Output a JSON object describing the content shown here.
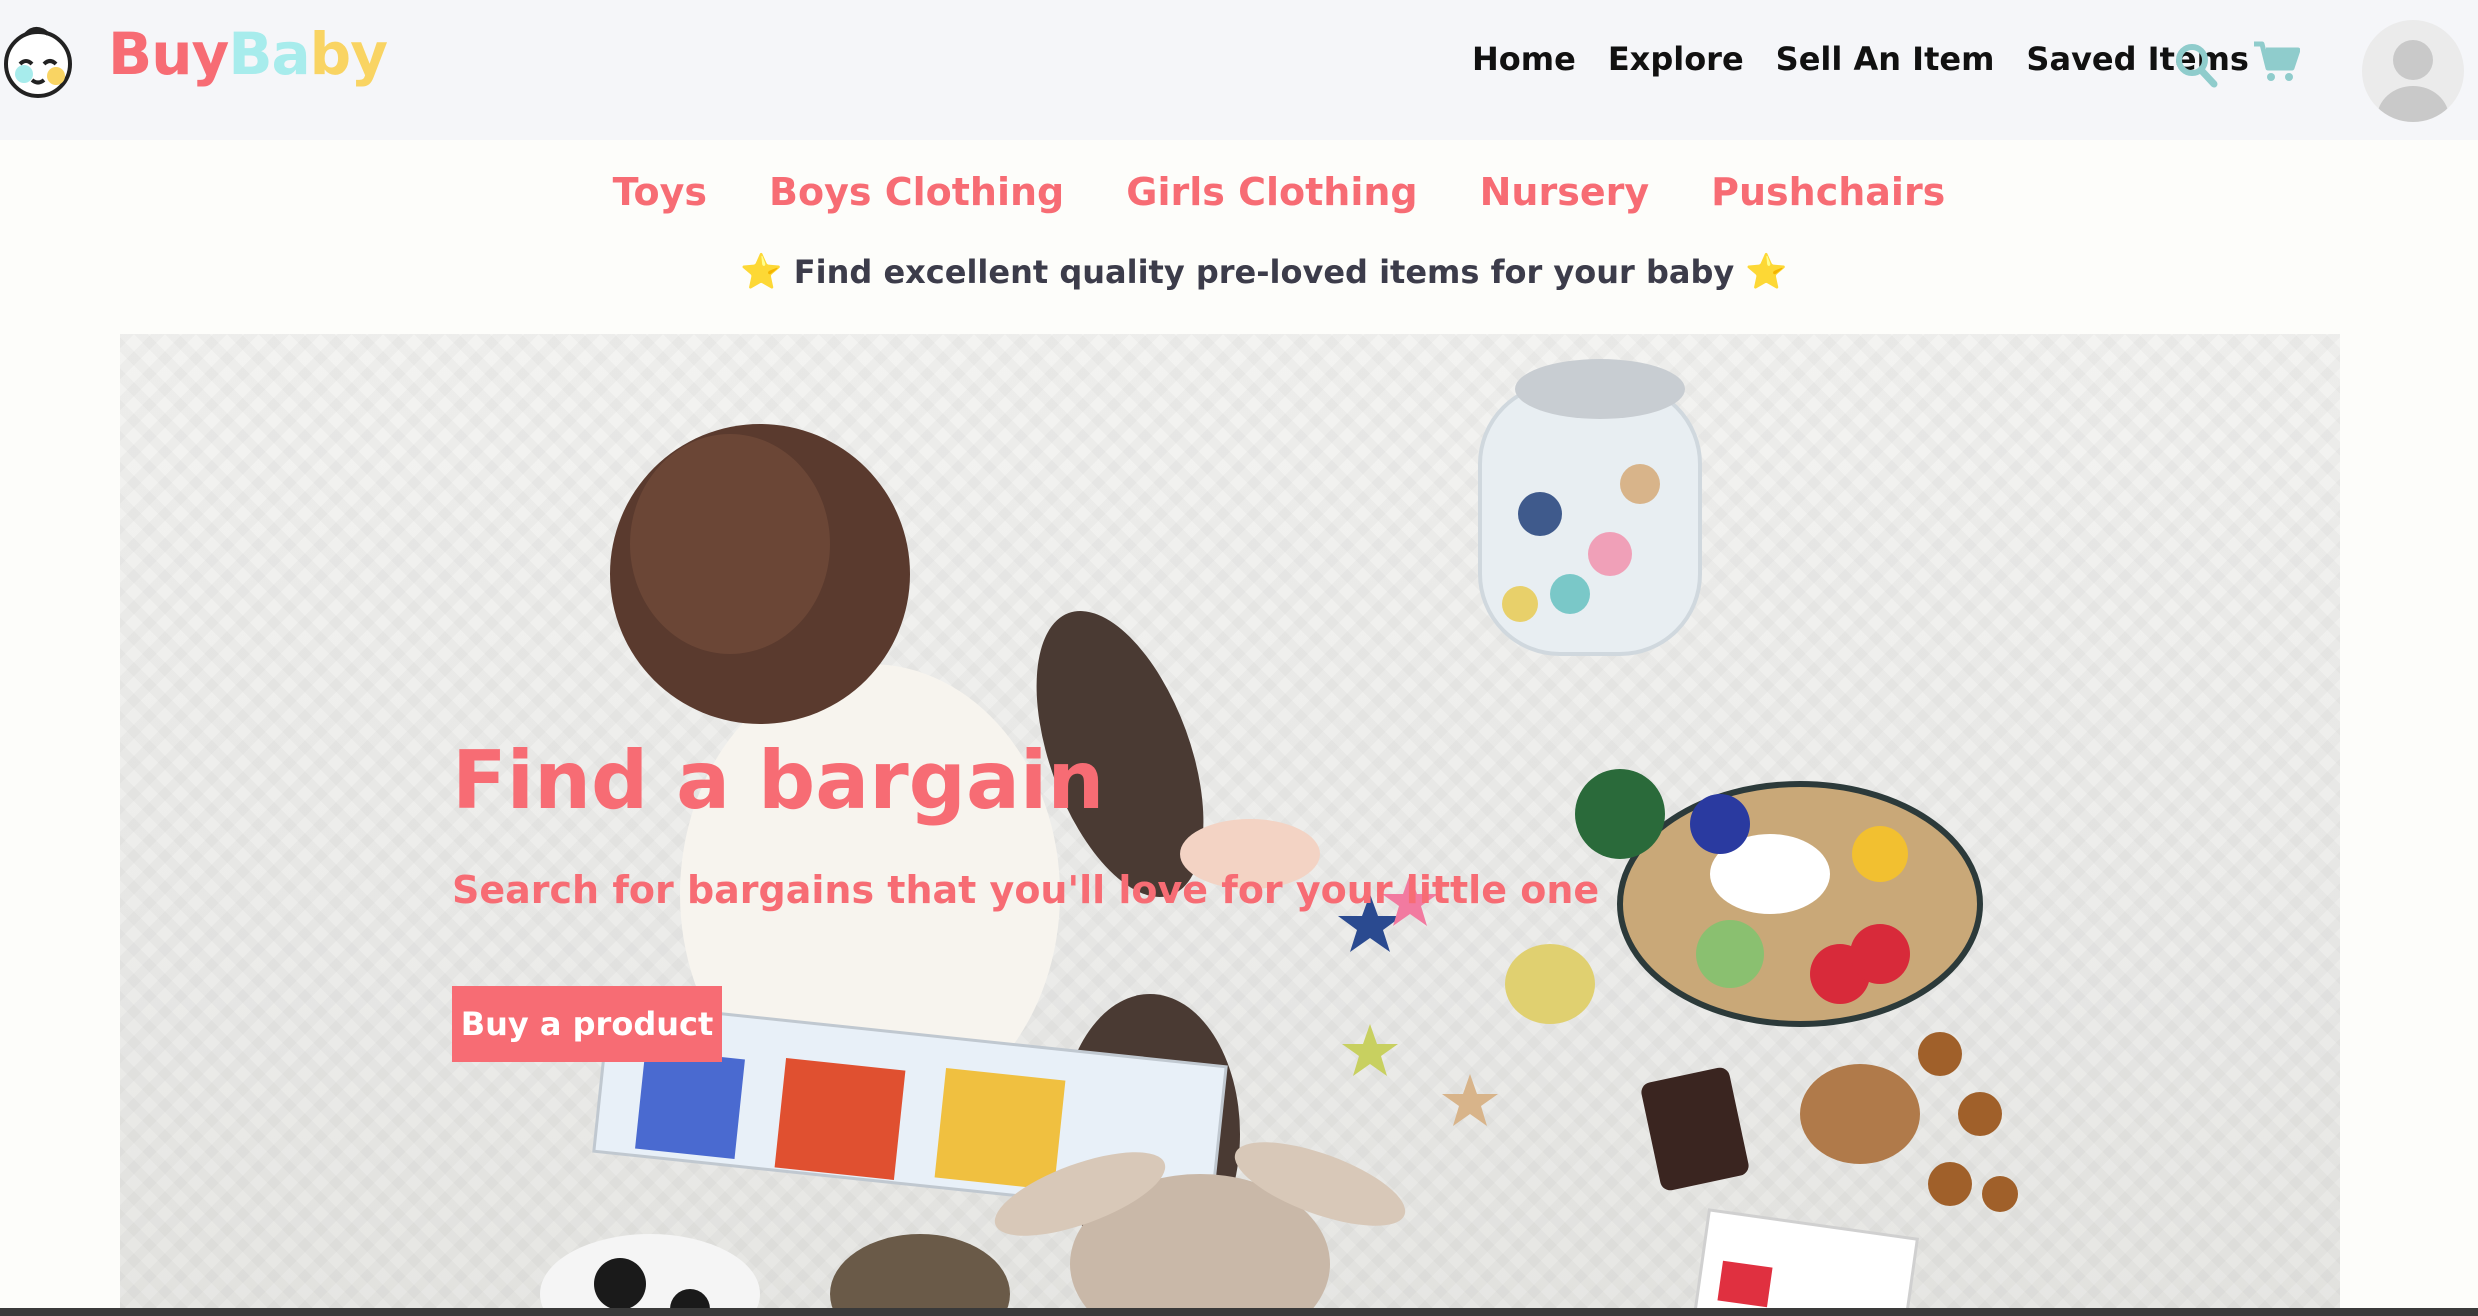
{
  "header": {
    "brand_part1": "Buy",
    "brand_part2": "Ba",
    "brand_part3": "by",
    "logo_icon": "baby-face-icon",
    "nav": [
      "Home",
      "Explore",
      "Sell An Item",
      "Saved Items"
    ],
    "search_icon": "search-icon",
    "cart_icon": "cart-icon",
    "avatar_icon": "user-avatar-icon"
  },
  "categories": [
    "Toys",
    "Boys Clothing",
    "Girls Clothing",
    "Nursery",
    "Pushchairs"
  ],
  "tagline": {
    "star_left": "⭐",
    "text": "Find excellent quality pre-loved items for your baby",
    "star_right": "⭐"
  },
  "hero": {
    "title": "Find a bargain",
    "subtitle": "Search for bargains that you'll love for your little one",
    "button_label": "Buy a product"
  },
  "colors": {
    "accent": "#f76c74",
    "brand_teal": "#a7ecec",
    "brand_yellow": "#f9d463",
    "icon_teal": "#8fcccc",
    "nav_bg": "#f5f6f9"
  }
}
